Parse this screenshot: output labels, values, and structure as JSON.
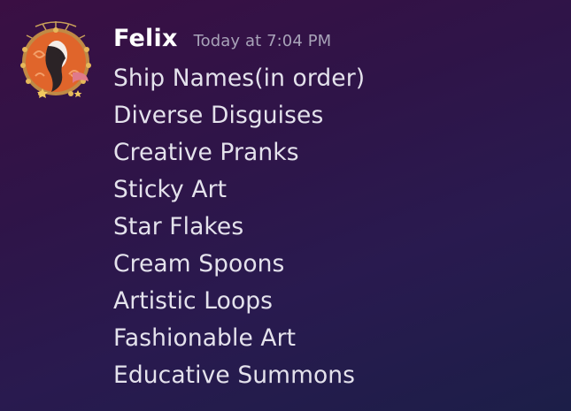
{
  "message": {
    "author": "Felix",
    "timestamp": "Today at 7:04 PM",
    "lines": [
      "Ship Names(in order)",
      "Diverse Disguises",
      "Creative Pranks",
      "Sticky Art",
      "Star Flakes",
      "Cream Spoons",
      "Artistic Loops",
      "Fashionable Art",
      "Educative Summons"
    ]
  },
  "colors": {
    "background_top_left": "#3a0f43",
    "background_bottom_right": "#1c1e48",
    "username": "#ffffff",
    "timestamp": "#a8a3b8",
    "message_text": "#e4e2ec",
    "avatar_orange": "#e0652b"
  },
  "icons": {
    "avatar": "user-avatar-icon"
  }
}
